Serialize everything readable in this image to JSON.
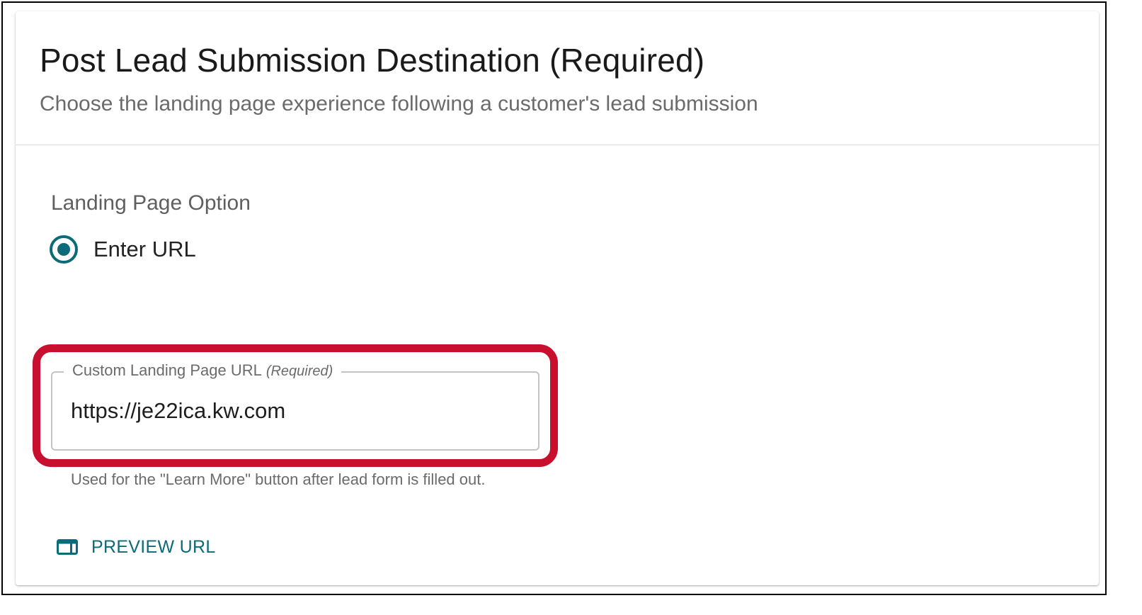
{
  "card": {
    "title": "Post Lead Submission Destination (Required)",
    "subtitle": "Choose the landing page experience following a customer's lead submission"
  },
  "landing_option": {
    "label": "Landing Page Option",
    "radio_label": "Enter URL",
    "selected": true
  },
  "url_field": {
    "label": "Custom Landing Page URL",
    "required_tag": "(Required)",
    "value": "https://je22ica.kw.com",
    "helper_text": "Used for the \"Learn More\" button after lead form is filled out."
  },
  "preview": {
    "label": "PREVIEW URL",
    "icon": "preview-window-icon"
  },
  "colors": {
    "accent": "#0b6b78",
    "highlight": "#c8102e",
    "title_text": "#1a1a1a",
    "muted_text": "#6b6b6b"
  }
}
